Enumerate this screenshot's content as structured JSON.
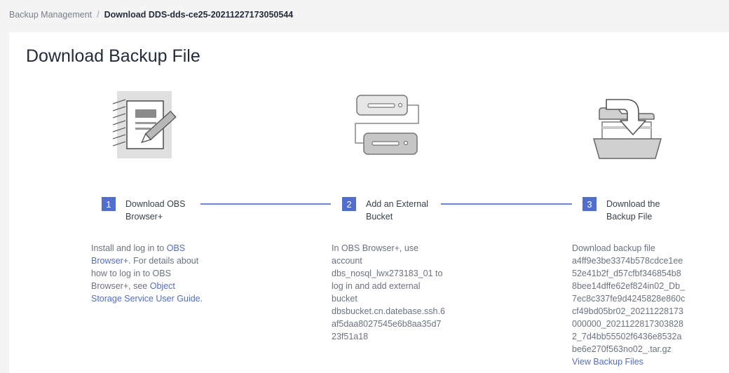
{
  "breadcrumb": {
    "parent": "Backup Management",
    "separator": "/",
    "current": "Download DDS-dds-ce25-20211227173050544"
  },
  "page": {
    "title": "Download Backup File"
  },
  "steps": [
    {
      "number": "1",
      "title_line1": "Download OBS",
      "title_line2": "Browser+",
      "icon": "notepad-pencil-icon",
      "desc": {
        "lines": [
          "Install and log in to",
          "For details about",
          "how to log in to OBS",
          "Browser+, see"
        ],
        "link_obs_a": "OBS",
        "link_obs_b": "Browser+",
        "link_guide_a": "Object",
        "link_guide_b": "Storage Service User Guide",
        "period_a": ".",
        "period_b": "."
      }
    },
    {
      "number": "2",
      "title_line1": "Add an External",
      "title_line2": "Bucket",
      "icon": "linked-buckets-icon",
      "desc": {
        "lines": [
          "In OBS Browser+, use",
          "account",
          "dbs_nosql_lwx273183_01 to",
          "log in and add external",
          "bucket",
          "dbsbucket.cn.datebase.ssh.6",
          "af5daa8027545e6b8aa35d7",
          "23f51a18"
        ]
      }
    },
    {
      "number": "3",
      "title_line1": "Download the",
      "title_line2": "Backup File",
      "icon": "folder-download-icon",
      "desc": {
        "lines": [
          "Download backup file",
          "a4ff9e3be3374b578cdce1ee",
          "52e41b2f_d57cfbf346854b8",
          "8bee14dffe62ef824in02_Db_",
          "7ec8c337fe9d4245828e860c",
          "cf49bd05br02_20211228173",
          "000000_2021122817303828",
          "2_7d4bb55502f6436e8532a",
          "be6e270f563no02_.tar.gz"
        ],
        "link": "View Backup Files"
      }
    }
  ],
  "colors": {
    "accent": "#526ecc",
    "connector": "#6b84d8",
    "text_muted": "#6c7280"
  }
}
